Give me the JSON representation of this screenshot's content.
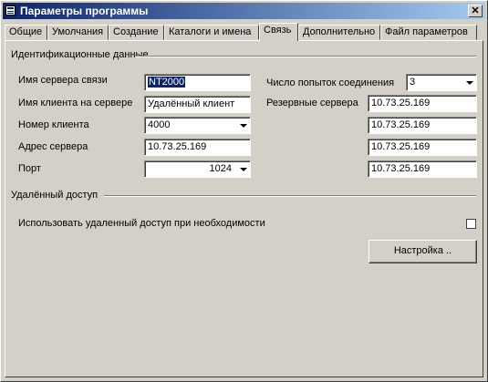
{
  "window": {
    "title": "Параметры программы",
    "close_label": "✕"
  },
  "tabs": [
    "Общие",
    "Умолчания",
    "Создание",
    "Каталоги и имена",
    "Связь",
    "Дополнительно",
    "Файл параметров"
  ],
  "ident": {
    "header": "Идентификационные данные",
    "server_name_label": "Имя сервера связи",
    "server_name_value": "NT2000",
    "client_name_label": "Имя клиента на сервере",
    "client_name_value": "Удалённый клиент",
    "client_number_label": "Номер клиента",
    "client_number_value": "4000",
    "server_address_label": "Адрес сервера",
    "server_address_value": "10.73.25.169",
    "port_label": "Порт",
    "port_value": "1024",
    "attempts_label": "Число попыток соединения",
    "attempts_value": "3",
    "reserve_label": "Резервные сервера",
    "reserve_servers": [
      "10.73.25.169",
      "10.73.25.169",
      "10.73.25.169",
      "10.73.25.169"
    ]
  },
  "remote": {
    "header": "Удалённый доступ",
    "use_label": "Использовать удаленный доступ при необходимости",
    "settings_button": "Настройка .."
  }
}
